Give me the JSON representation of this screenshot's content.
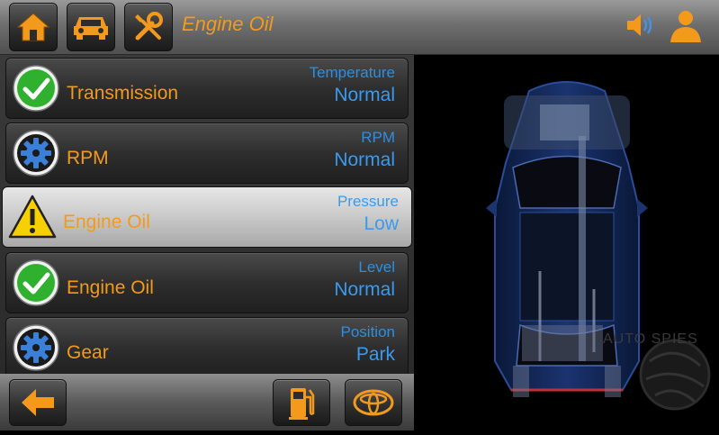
{
  "header": {
    "title": "Engine Oil",
    "buttons": [
      {
        "name": "home",
        "icon": "home-icon"
      },
      {
        "name": "vehicle",
        "icon": "car-icon"
      },
      {
        "name": "tools",
        "icon": "wrench-screwdriver-icon"
      }
    ],
    "right_icons": [
      "speaker-icon",
      "user-icon"
    ]
  },
  "rows": [
    {
      "label": "Transmission",
      "caption": "Temperature",
      "value": "Normal",
      "status": "ok",
      "icon": "checkmark-icon"
    },
    {
      "label": "RPM",
      "caption": "RPM",
      "value": "Normal",
      "status": "info",
      "icon": "gear-icon"
    },
    {
      "label": "Engine Oil",
      "caption": "Pressure",
      "value": "Low",
      "status": "warning",
      "icon": "warning-icon",
      "selected": true
    },
    {
      "label": "Engine Oil",
      "caption": "Level",
      "value": "Normal",
      "status": "ok",
      "icon": "checkmark-icon"
    },
    {
      "label": "Gear",
      "caption": "Position",
      "value": "Park",
      "status": "info",
      "icon": "gear-icon"
    }
  ],
  "footer": {
    "buttons": [
      "back-arrow-icon",
      "fuel-pump-icon",
      "toyota-logo-icon"
    ]
  },
  "watermark": "AUTO SPIES",
  "colors": {
    "accent": "#f39a1c",
    "value_blue": "#3a9af0",
    "ok_green": "#2fb02f"
  }
}
